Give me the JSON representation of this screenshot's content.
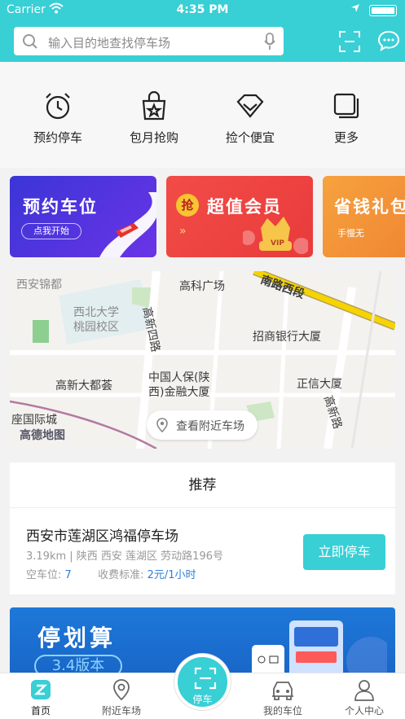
{
  "status_bar": {
    "carrier": "Carrier",
    "time": "4:35 PM"
  },
  "search": {
    "placeholder": "输入目的地查找停车场"
  },
  "quick_actions": [
    {
      "label": "预约停车",
      "icon": "alarm-clock-icon"
    },
    {
      "label": "包月抢购",
      "icon": "shopping-bag-star-icon"
    },
    {
      "label": "捡个便宜",
      "icon": "diamond-icon"
    },
    {
      "label": "更多",
      "icon": "stacked-squares-icon"
    }
  ],
  "promos": [
    {
      "title": "预约车位",
      "button": "点我开始",
      "color": "#4b36de"
    },
    {
      "title": "超值会员",
      "badge": "抢",
      "tag": "VIP",
      "color": "#ec4343"
    },
    {
      "title": "省钱礼包",
      "subtitle": "手慢无",
      "color": "#f39a39"
    }
  ],
  "map": {
    "labels": [
      "西安锦都",
      "高科广场",
      "南路西段",
      "西北大学",
      "桃园校区",
      "高新四路",
      "招商银行大厦",
      "中国人保(陕",
      "西)金融大厦",
      "高新大都荟",
      "正信大厦",
      "座国际城",
      "高新路",
      "高德地图"
    ],
    "nearby_button": "查看附近车场"
  },
  "recommend": {
    "header": "推荐",
    "lot_name": "西安市莲湖区鸿福停车场",
    "address": "3.19km | 陕西 西安 莲湖区 劳动路196号",
    "spaces_label": "空车位:",
    "spaces_value": "7",
    "fee_label": "收费标准:",
    "fee_value": "2元/1小时",
    "button": "立即停车"
  },
  "banner": {
    "title": "停划算",
    "version": "3.4版本"
  },
  "tabbar": {
    "tabs": [
      {
        "label": "首页",
        "icon": "home-icon"
      },
      {
        "label": "附近车场",
        "icon": "location-pin-icon"
      },
      {
        "label": "停车",
        "icon": "scan-icon"
      },
      {
        "label": "我的车位",
        "icon": "car-icon"
      },
      {
        "label": "个人中心",
        "icon": "person-icon"
      }
    ]
  },
  "colors": {
    "accent": "#38cfd5",
    "link": "#2d7fd6"
  }
}
